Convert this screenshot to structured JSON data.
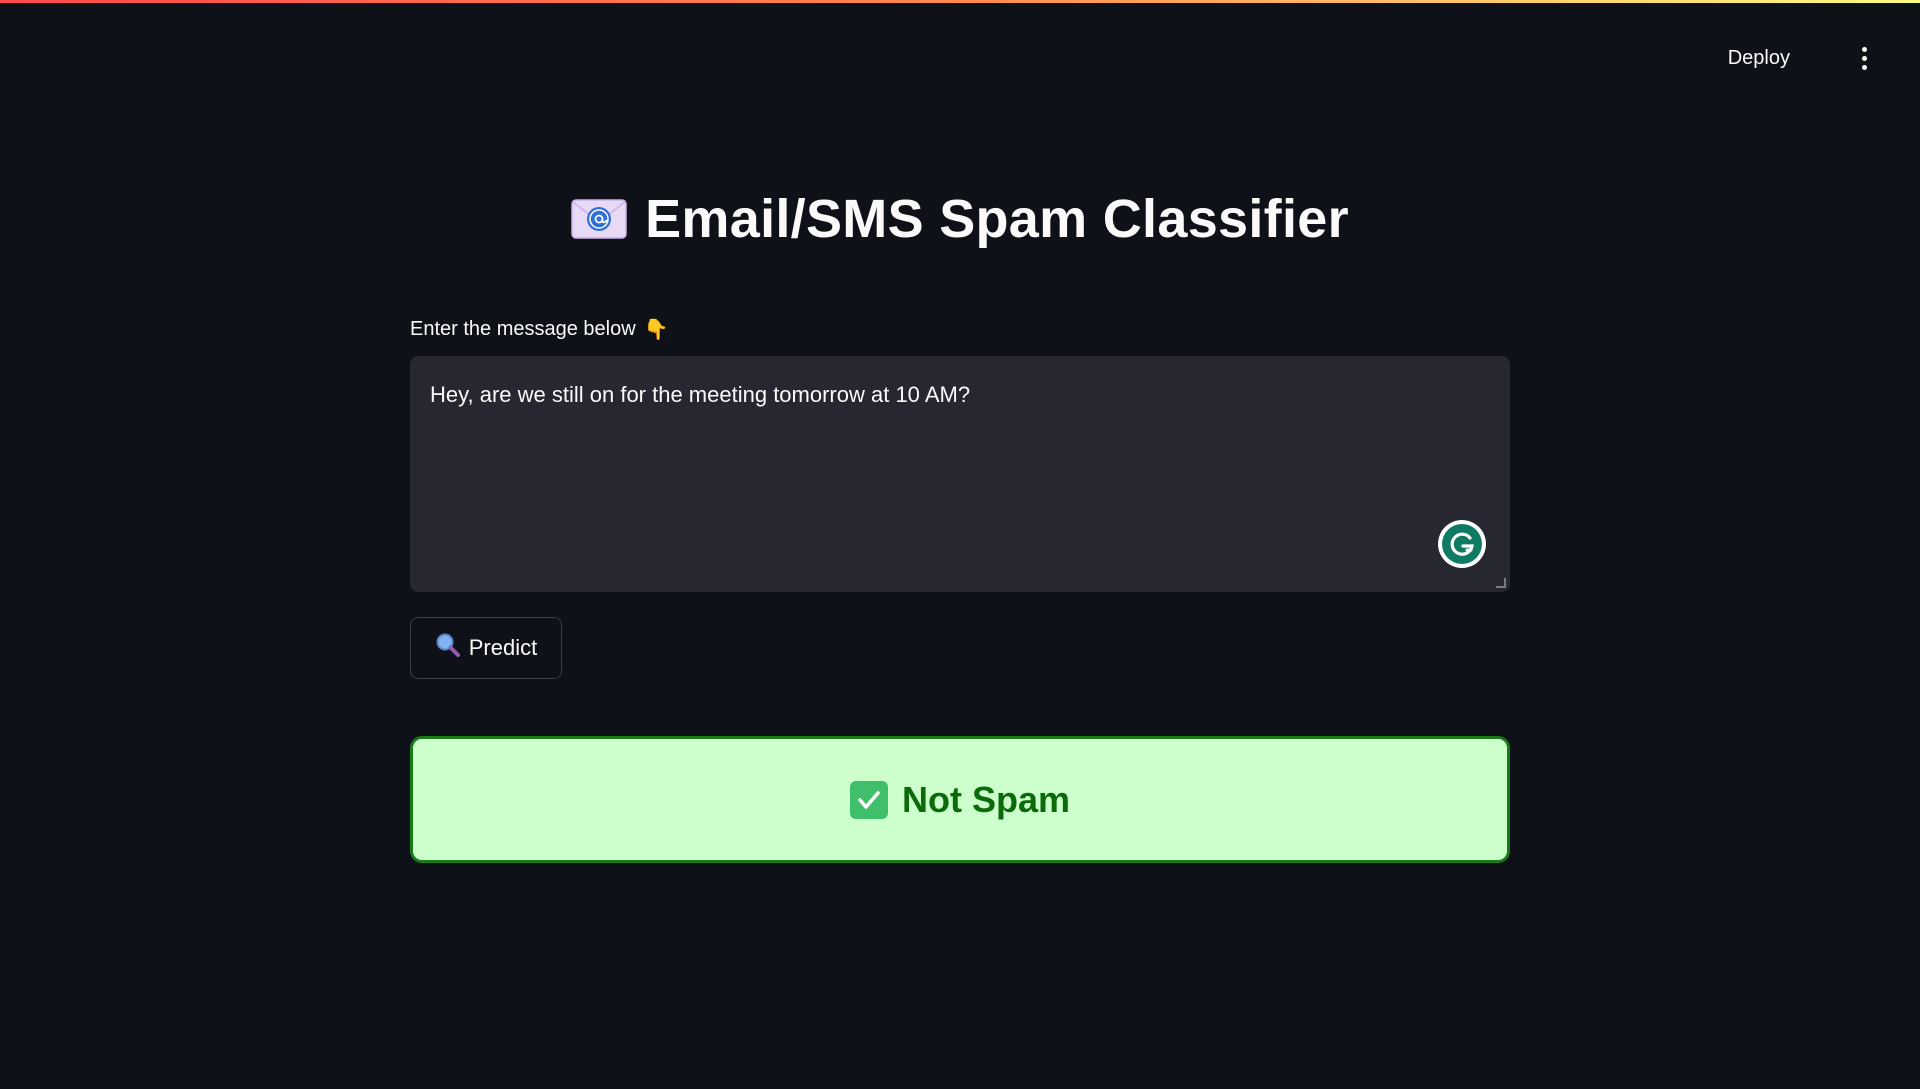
{
  "header": {
    "deploy_label": "Deploy",
    "menu_icon": "vertical-ellipsis-icon"
  },
  "colors": {
    "background": "#0e1117",
    "input_background": "#262730",
    "result_background": "#ccffcc",
    "result_border": "#1a7a1a",
    "result_text": "#0b6b0b"
  },
  "main": {
    "title": "Email/SMS Spam Classifier",
    "title_icon": "email-envelope-icon",
    "input_label": "Enter the message below",
    "input_label_icon": "pointing-down-icon",
    "message_value": "Hey, are we still on for the meeting tomorrow at 10 AM?",
    "predict_label": "Predict",
    "predict_icon": "magnifier-icon",
    "result_label": "Not Spam",
    "result_icon": "check-mark-icon"
  }
}
